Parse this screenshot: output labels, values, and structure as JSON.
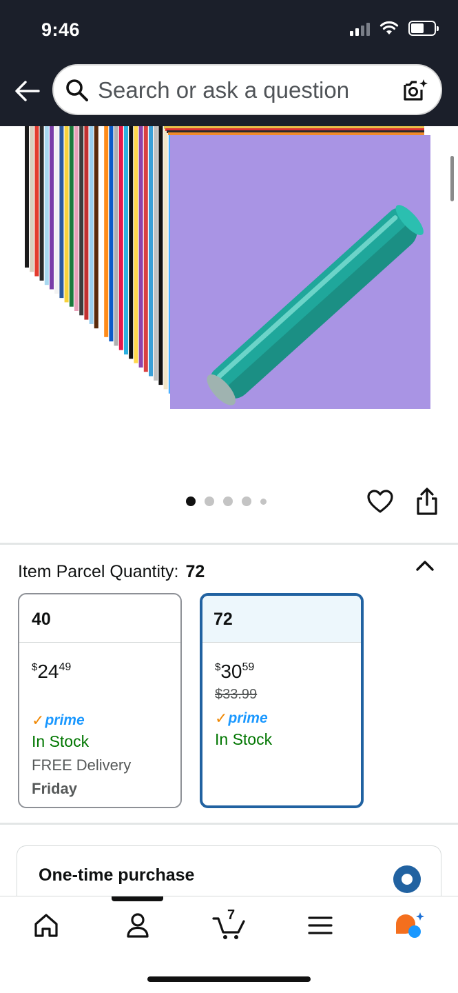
{
  "status_bar": {
    "time": "9:46"
  },
  "header": {
    "search_placeholder": "Search or ask a question"
  },
  "gallery": {
    "image_count": 5,
    "active_index": 0
  },
  "quantity": {
    "label": "Item Parcel Quantity:",
    "selected_value": "72",
    "options": [
      {
        "size": "40",
        "price_symbol": "$",
        "price_whole": "24",
        "price_fraction": "49",
        "list_price": "",
        "prime": "prime",
        "stock": "In Stock",
        "delivery": "FREE Delivery",
        "delivery_day": "Friday",
        "selected": false
      },
      {
        "size": "72",
        "price_symbol": "$",
        "price_whole": "30",
        "price_fraction": "59",
        "list_price": "$33.99",
        "prime": "prime",
        "stock": "In Stock",
        "delivery": "",
        "delivery_day": "",
        "selected": true
      }
    ]
  },
  "purchase": {
    "one_time_label": "One-time purchase"
  },
  "bottom_nav": {
    "cart_count": "7",
    "active_item": "account"
  },
  "colors": {
    "header_bg": "#1b1f2a",
    "selected_border": "#2162a1",
    "selected_header_bg": "#edf7fc",
    "stock_green": "#007600",
    "prime_blue": "#1a98ff",
    "prime_check": "#f08804",
    "vinyl_sheet": "#a994e4",
    "roll_teal": "#1fa79b"
  }
}
